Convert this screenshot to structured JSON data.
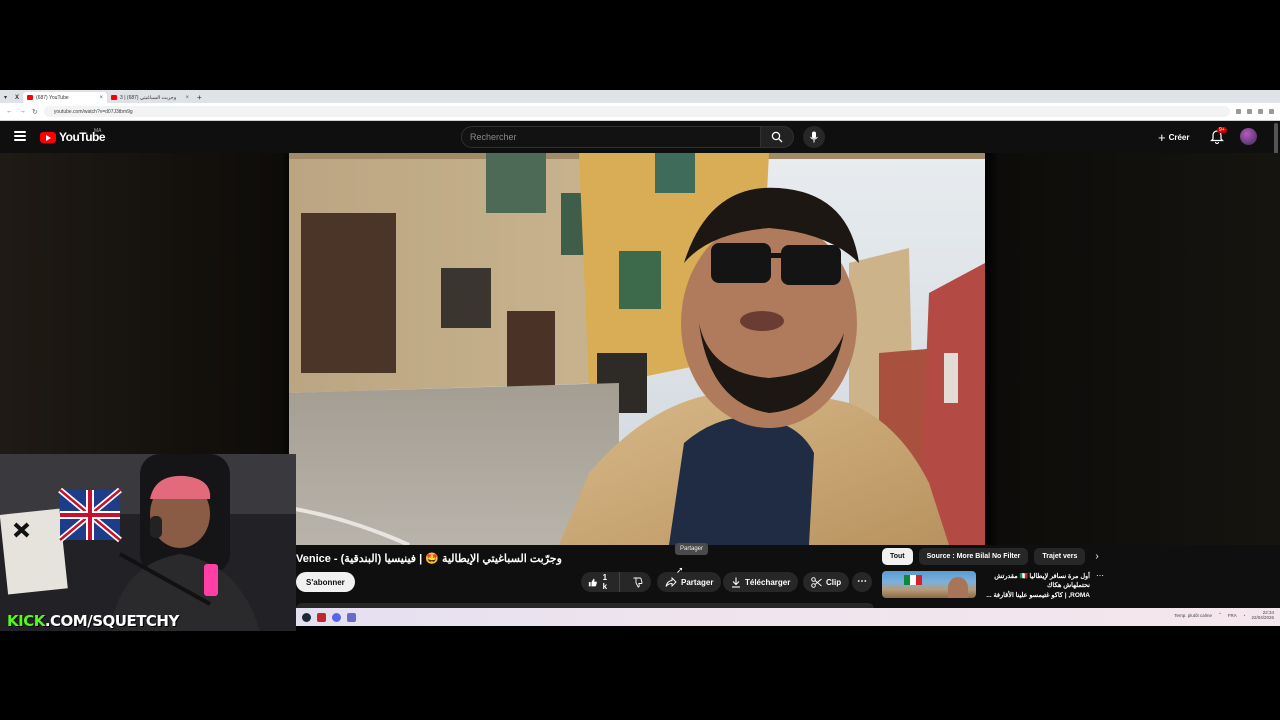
{
  "browser": {
    "tabs": [
      {
        "label": "X"
      },
      {
        "label": "(687) YouTube"
      },
      {
        "label": "3 | وجربت السباغيتي (687)"
      }
    ],
    "url": "youtube.com/watch?v=d07J3tbm9g"
  },
  "header": {
    "logo_text": "YouTube",
    "region": "MA",
    "search_placeholder": "Rechercher",
    "create_label": "Créer",
    "notification_count": "9+"
  },
  "video": {
    "title": "Venice - وجرّبت السباغيتي الإيطالية 🤩 | فينيسيا (البندقية)",
    "subscribe_label": "S'abonner",
    "like_count": "1 k",
    "share_label": "Partager",
    "download_label": "Télécharger",
    "clip_label": "Clip",
    "share_tooltip": "Partager"
  },
  "sidebar": {
    "chips": [
      {
        "label": "Tout",
        "active": true
      },
      {
        "label": "Source : More Bilal No Filter",
        "active": false
      },
      {
        "label": "Trajet vers",
        "active": false
      }
    ],
    "recommendation": {
      "title_line1": "أول مرة نسافر لإيطاليا 🇮🇹 مقدرتش نحتملهاش هكاك",
      "title_line2": "ROMA, | كاكو غتيمسو علينا الأقارفة ..."
    }
  },
  "taskbar": {
    "time": "22:34",
    "date": "22/04/2026",
    "lang": "FRA",
    "weather": "Temp. plutôt calme"
  },
  "stream_overlay": {
    "kick_prefix": "KICK",
    "kick_suffix": ".COM/SQUETCHY"
  }
}
